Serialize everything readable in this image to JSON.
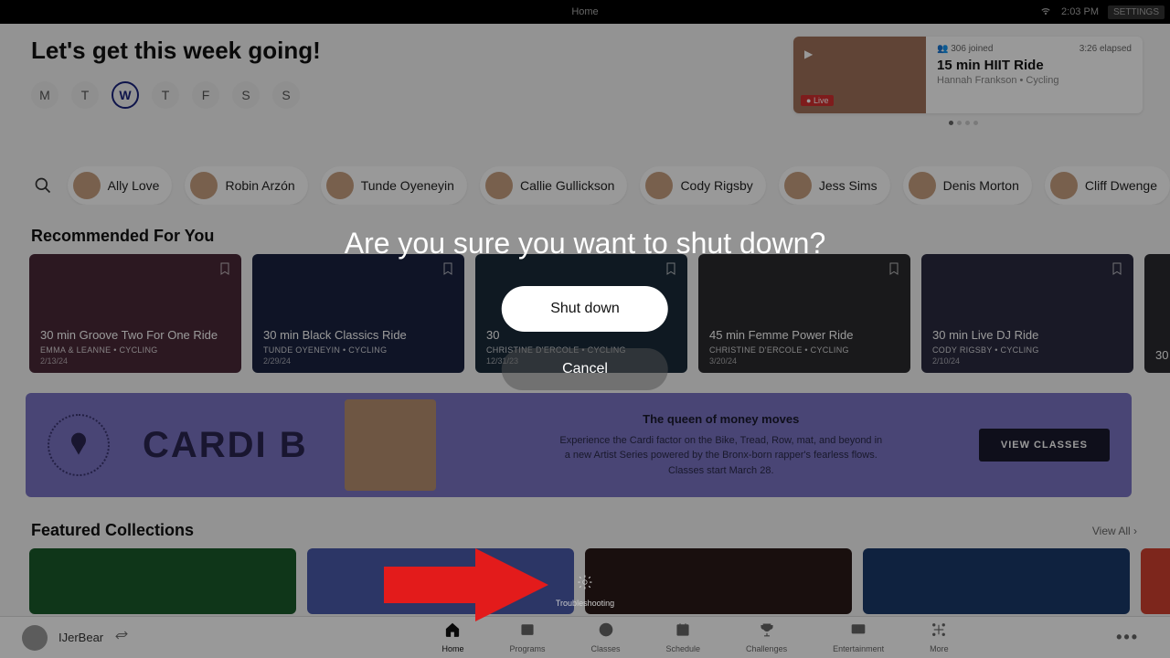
{
  "topbar": {
    "title": "Home",
    "time": "2:03 PM",
    "settings": "SETTINGS"
  },
  "header": {
    "greeting": "Let's get this week going!",
    "days": [
      "M",
      "T",
      "W",
      "T",
      "F",
      "S",
      "S"
    ],
    "active_day_index": 2
  },
  "live": {
    "joined": "306 joined",
    "elapsed": "3:26 elapsed",
    "title": "15 min HIIT Ride",
    "subtitle": "Hannah Frankson • Cycling",
    "badge": "Live"
  },
  "instructors": [
    "Ally Love",
    "Robin Arzón",
    "Tunde Oyeneyin",
    "Callie Gullickson",
    "Cody Rigsby",
    "Jess Sims",
    "Denis Morton",
    "Cliff Dwenge"
  ],
  "recommended": {
    "title": "Recommended For You",
    "cards": [
      {
        "title": "30 min Groove Two For One Ride",
        "meta": "EMMA & LEANNE  •  CYCLING",
        "date": "2/13/24",
        "bg": "#4a2838"
      },
      {
        "title": "30 min Black Classics Ride",
        "meta": "TUNDE OYENEYIN  •  CYCLING",
        "date": "2/29/24",
        "bg": "#1a2240"
      },
      {
        "title": "30",
        "meta": "CHRISTINE D'ERCOLE  •  CYCLING",
        "date": "12/31/23",
        "bg": "#1a2a3a"
      },
      {
        "title": "45 min Femme Power Ride",
        "meta": "CHRISTINE D'ERCOLE  •  CYCLING",
        "date": "3/20/24",
        "bg": "#2a2a2e"
      },
      {
        "title": "30 min Live DJ Ride",
        "meta": "CODY RIGSBY  •  CYCLING",
        "date": "2/10/24",
        "bg": "#2a2a40"
      },
      {
        "title": "30",
        "meta": "",
        "date": "",
        "bg": "#2a2a30"
      }
    ]
  },
  "promo": {
    "artist": "CARDI B",
    "headline": "The queen of money moves",
    "desc": "Experience the Cardi factor on the Bike, Tread, Row, mat, and beyond in a new Artist Series powered by the Bronx-born rapper's fearless flows. Classes start March 28.",
    "button": "VIEW CLASSES"
  },
  "featured": {
    "title": "Featured Collections",
    "viewall": "View All  ›",
    "cards": [
      {
        "bg": "#1a5a2a"
      },
      {
        "bg": "#4a5aaa"
      },
      {
        "bg": "#2a1a18"
      },
      {
        "bg": "#1a3a6a"
      },
      {
        "bg": "#d04030"
      }
    ]
  },
  "nav": {
    "username": "IJerBear",
    "items": [
      "Home",
      "Programs",
      "Classes",
      "Schedule",
      "Challenges",
      "Entertainment",
      "More"
    ]
  },
  "tooltip": {
    "label": "Troubleshooting"
  },
  "modal": {
    "title": "Are you sure you want to shut down?",
    "primary": "Shut down",
    "secondary": "Cancel"
  }
}
